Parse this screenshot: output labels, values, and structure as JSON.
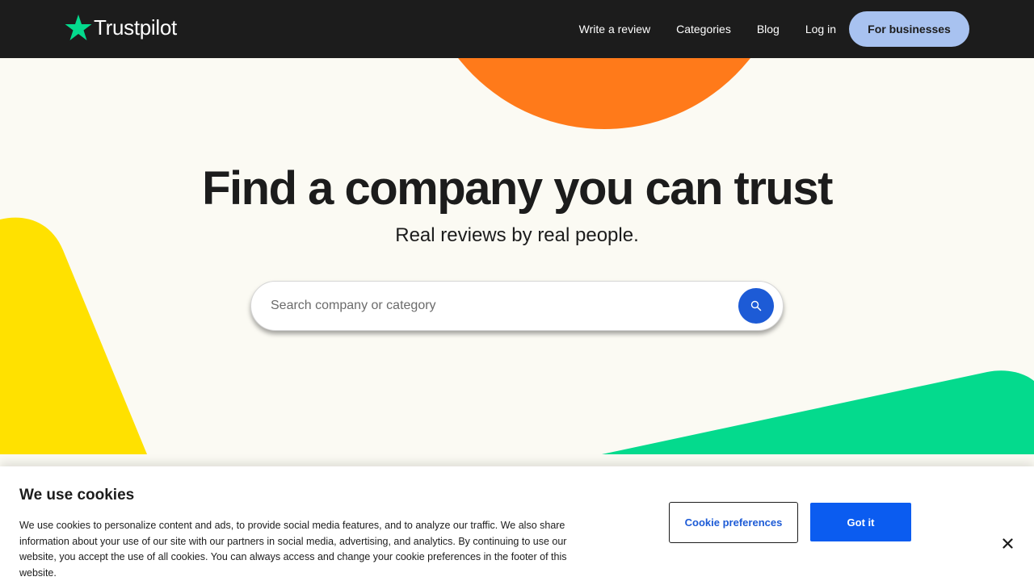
{
  "header": {
    "logo_text": "Trustpilot",
    "nav": {
      "write_review": "Write a review",
      "categories": "Categories",
      "blog": "Blog",
      "login": "Log in"
    },
    "business_button": "For businesses"
  },
  "hero": {
    "title": "Find a company you can trust",
    "subtitle": "Real reviews by real people.",
    "search": {
      "placeholder": "Search company or category",
      "value": "",
      "button_icon": "search-icon"
    }
  },
  "cookie_banner": {
    "title": "We use cookies",
    "text": "We use cookies to personalize content and ads, to provide social media features, and to analyze our traffic. We also share information about your use of our site with our partners in social media, advertising, and analytics. By continuing to use our website, you accept the use of all cookies. You can always access and change your cookie preferences in the footer of this website.",
    "preferences_button": "Cookie preferences",
    "accept_button": "Got it",
    "close_icon": "close-icon"
  },
  "colors": {
    "header_bg": "#1c1c1c",
    "hero_bg": "#fbfaf3",
    "brand_green": "#04da8d",
    "orange": "#ff7a1a",
    "yellow": "#ffe100",
    "business_button": "#a8c2f0",
    "primary_blue": "#0b5cf0"
  }
}
